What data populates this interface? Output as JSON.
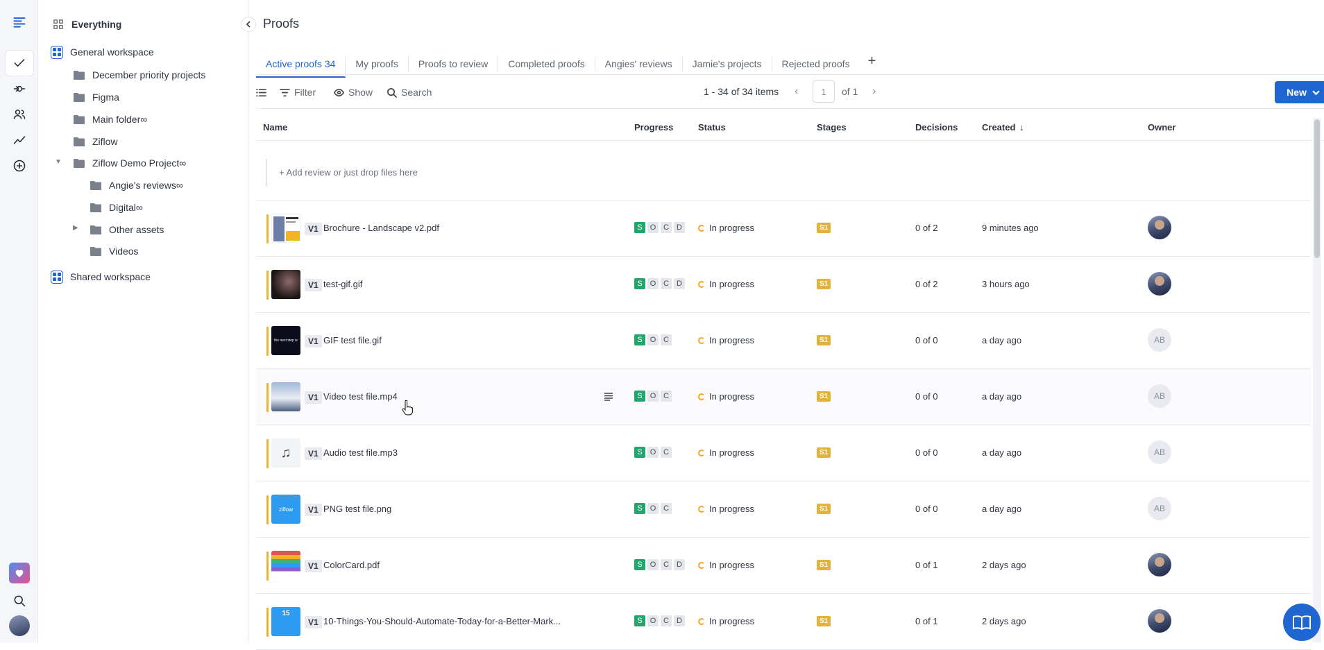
{
  "sidebar": {
    "everything_label": "Everything",
    "workspaces": [
      {
        "label": "General workspace"
      },
      {
        "label": "Shared workspace"
      }
    ],
    "folders": [
      {
        "label": "December priority projects"
      },
      {
        "label": "Figma"
      },
      {
        "label": "Main folder∞"
      },
      {
        "label": "Ziflow"
      },
      {
        "label": "Ziflow Demo Project∞"
      },
      {
        "label": "Angie's reviews∞"
      },
      {
        "label": "Digital∞"
      },
      {
        "label": "Other assets"
      },
      {
        "label": "Videos"
      }
    ]
  },
  "page": {
    "title": "Proofs"
  },
  "tabs": [
    {
      "label": "Active proofs 34"
    },
    {
      "label": "My proofs"
    },
    {
      "label": "Proofs to review"
    },
    {
      "label": "Completed proofs"
    },
    {
      "label": "Angies' reviews"
    },
    {
      "label": "Jamie's projects"
    },
    {
      "label": "Rejected proofs"
    }
  ],
  "tab_add_label": "+",
  "toolbar": {
    "filter_label": "Filter",
    "show_label": "Show",
    "search_label": "Search",
    "pager_text": "1 - 34 of 34 items",
    "page_value": "1",
    "page_of": "of 1",
    "new_label": "New"
  },
  "columns": {
    "name": "Name",
    "progress": "Progress",
    "status": "Status",
    "stages": "Stages",
    "decisions": "Decisions",
    "created": "Created",
    "owner": "Owner"
  },
  "add_review_text": "+ Add review or just drop files here",
  "rows": [
    {
      "version": "V1",
      "name": "Brochure - Landscape v2.pdf",
      "progress": [
        "S",
        "O",
        "C",
        "D"
      ],
      "status": "In progress",
      "stage": "S1",
      "decisions": "0 of 2",
      "created": "9 minutes ago",
      "owner": ""
    },
    {
      "version": "V1",
      "name": "test-gif.gif",
      "progress": [
        "S",
        "O",
        "C",
        "D"
      ],
      "status": "In progress",
      "stage": "S1",
      "decisions": "0 of 2",
      "created": "3 hours ago",
      "owner": ""
    },
    {
      "version": "V1",
      "name": "GIF test file.gif",
      "progress": [
        "S",
        "O",
        "C"
      ],
      "status": "In progress",
      "stage": "S1",
      "decisions": "0 of 0",
      "created": "a day ago",
      "owner": "AB"
    },
    {
      "version": "V1",
      "name": "Video test file.mp4",
      "progress": [
        "S",
        "O",
        "C"
      ],
      "status": "In progress",
      "stage": "S1",
      "decisions": "0 of 0",
      "created": "a day ago",
      "owner": "AB"
    },
    {
      "version": "V1",
      "name": "Audio test file.mp3",
      "progress": [
        "S",
        "O",
        "C"
      ],
      "status": "In progress",
      "stage": "S1",
      "decisions": "0 of 0",
      "created": "a day ago",
      "owner": "AB"
    },
    {
      "version": "V1",
      "name": "PNG test file.png",
      "progress": [
        "S",
        "O",
        "C"
      ],
      "status": "In progress",
      "stage": "S1",
      "decisions": "0 of 0",
      "created": "a day ago",
      "owner": "AB"
    },
    {
      "version": "V1",
      "name": "ColorCard.pdf",
      "progress": [
        "S",
        "O",
        "C",
        "D"
      ],
      "status": "In progress",
      "stage": "S1",
      "decisions": "0 of 1",
      "created": "2 days ago",
      "owner": ""
    },
    {
      "version": "V1",
      "name": "10-Things-You-Should-Automate-Today-for-a-Better-Mark...",
      "progress": [
        "S",
        "O",
        "C",
        "D"
      ],
      "status": "In progress",
      "stage": "S1",
      "decisions": "0 of 1",
      "created": "2 days ago",
      "owner": ""
    }
  ],
  "thumbnail_labels": {
    "gif_text": "the next step is",
    "png_text": "ziflow",
    "number_text": "15"
  },
  "colors": {
    "accent": "#1f66d1",
    "row_accent": "#f0b429",
    "progress_done": "#25a46d",
    "stage_badge": "#e3b23c"
  }
}
